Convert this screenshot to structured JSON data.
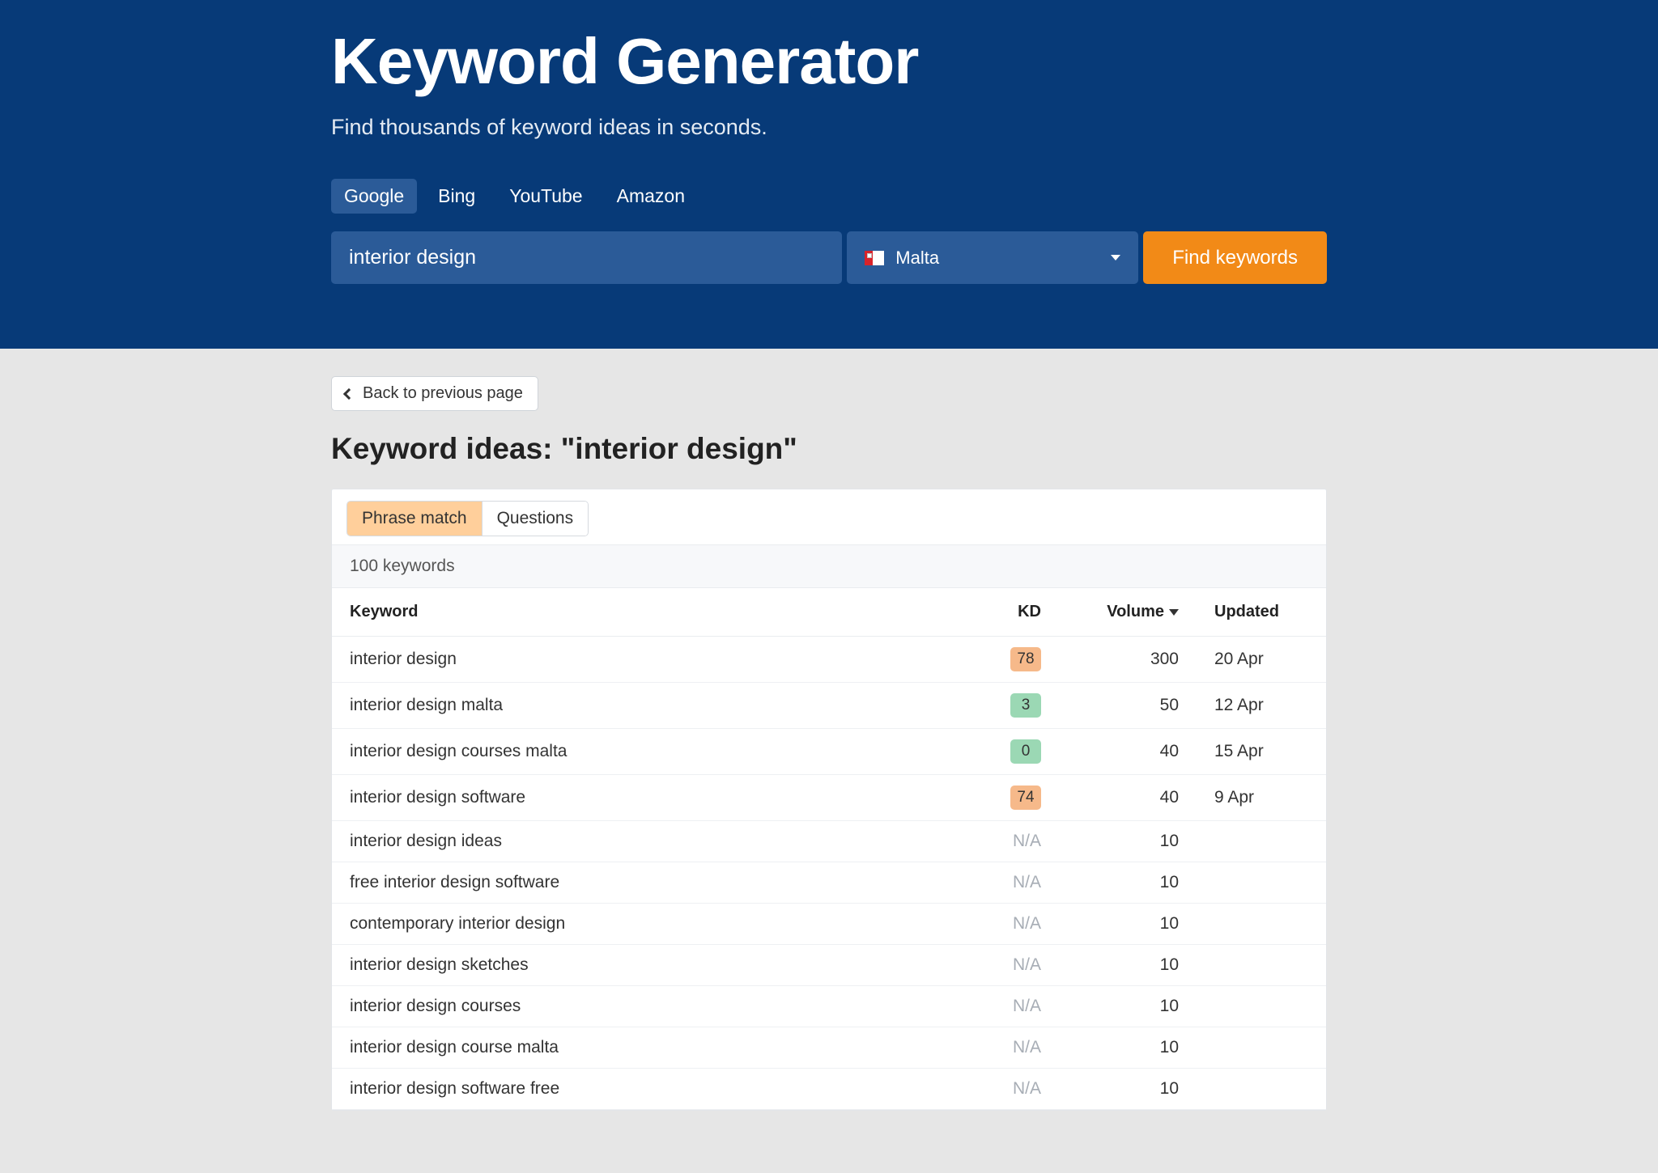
{
  "hero": {
    "title": "Keyword Generator",
    "subtitle": "Find thousands of keyword ideas in seconds."
  },
  "engines": [
    {
      "label": "Google",
      "active": true
    },
    {
      "label": "Bing",
      "active": false
    },
    {
      "label": "YouTube",
      "active": false
    },
    {
      "label": "Amazon",
      "active": false
    }
  ],
  "search": {
    "value": "interior design",
    "country": "Malta",
    "button": "Find keywords"
  },
  "back_label": "Back to previous page",
  "results_title": "Keyword ideas: \"interior design\"",
  "match_tabs": [
    {
      "label": "Phrase match",
      "active": true
    },
    {
      "label": "Questions",
      "active": false
    }
  ],
  "keyword_count": "100 keywords",
  "columns": {
    "keyword": "Keyword",
    "kd": "KD",
    "volume": "Volume",
    "updated": "Updated"
  },
  "rows": [
    {
      "keyword": "interior design",
      "kd": "78",
      "kd_color": "orange",
      "volume": "300",
      "updated": "20 Apr"
    },
    {
      "keyword": "interior design malta",
      "kd": "3",
      "kd_color": "green",
      "volume": "50",
      "updated": "12 Apr"
    },
    {
      "keyword": "interior design courses malta",
      "kd": "0",
      "kd_color": "green",
      "volume": "40",
      "updated": "15 Apr"
    },
    {
      "keyword": "interior design software",
      "kd": "74",
      "kd_color": "orange",
      "volume": "40",
      "updated": "9 Apr"
    },
    {
      "keyword": "interior design ideas",
      "kd": "N/A",
      "kd_color": "na",
      "volume": "10",
      "updated": ""
    },
    {
      "keyword": "free interior design software",
      "kd": "N/A",
      "kd_color": "na",
      "volume": "10",
      "updated": ""
    },
    {
      "keyword": "contemporary interior design",
      "kd": "N/A",
      "kd_color": "na",
      "volume": "10",
      "updated": ""
    },
    {
      "keyword": "interior design sketches",
      "kd": "N/A",
      "kd_color": "na",
      "volume": "10",
      "updated": ""
    },
    {
      "keyword": "interior design courses",
      "kd": "N/A",
      "kd_color": "na",
      "volume": "10",
      "updated": ""
    },
    {
      "keyword": "interior design course malta",
      "kd": "N/A",
      "kd_color": "na",
      "volume": "10",
      "updated": ""
    },
    {
      "keyword": "interior design software free",
      "kd": "N/A",
      "kd_color": "na",
      "volume": "10",
      "updated": ""
    }
  ]
}
